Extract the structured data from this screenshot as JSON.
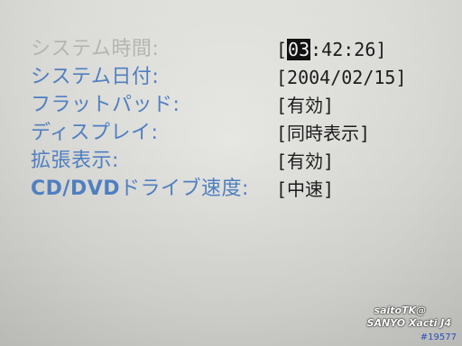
{
  "settings": {
    "rows": [
      {
        "label": "システム時間:",
        "value_pre": "",
        "value_cursor": "03",
        "value_post": ":42:26"
      },
      {
        "label": "システム日付:",
        "value": "2004/02/15"
      },
      {
        "label": "フラットパッド:",
        "value": "有効"
      },
      {
        "label": "ディスプレイ:",
        "value": "同時表示"
      },
      {
        "label": "拡張表示:",
        "value": "有効"
      },
      {
        "label_bold": "CD/DVD",
        "label": "ドライブ速度:",
        "value": "中速"
      }
    ],
    "bracket_open": "[",
    "bracket_close": "]"
  },
  "watermark": {
    "author": "saitoTK@",
    "camera": "SANYO Xacti J4",
    "photo_id": "#19577"
  },
  "colors": {
    "label_dim": "#b4b4b2",
    "label_blue": "#4f7fc0",
    "value_text": "#1c1c1c",
    "photo_id": "#2a4fbf"
  }
}
